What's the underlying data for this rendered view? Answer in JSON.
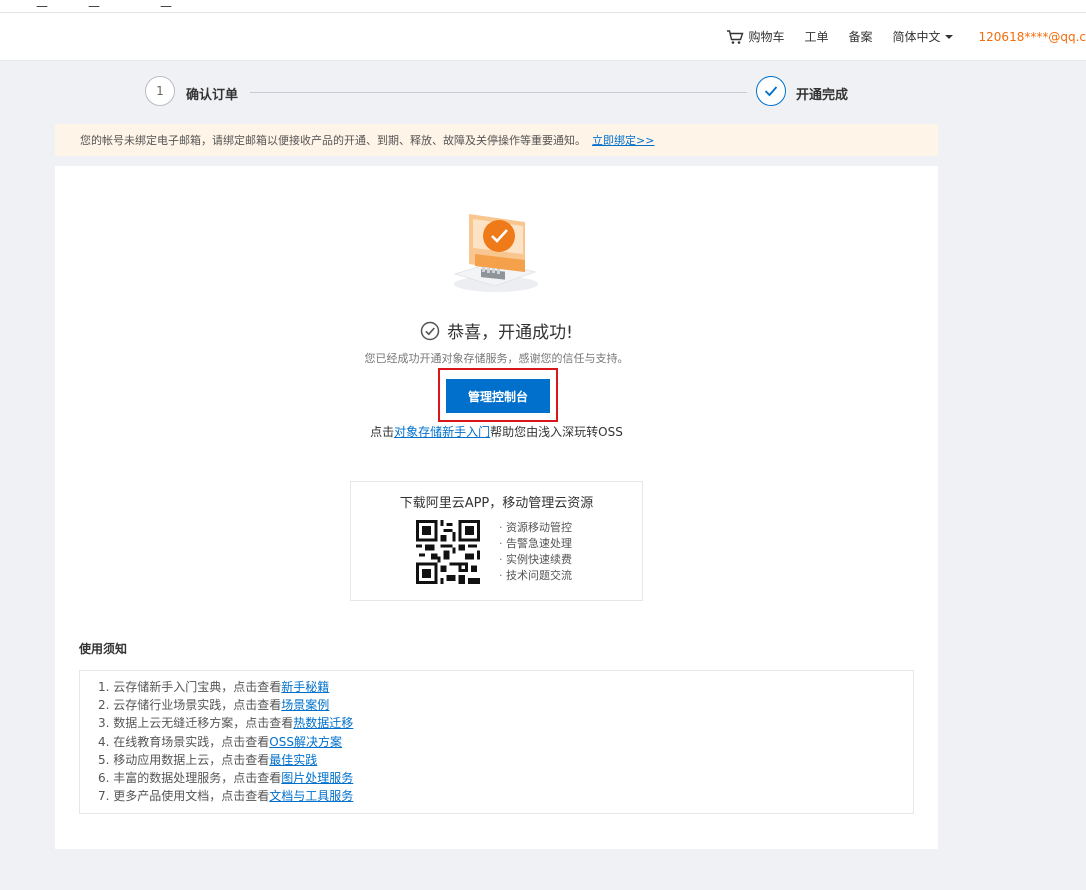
{
  "topbar": {
    "stubs": [
      "二",
      "二",
      "二"
    ]
  },
  "header": {
    "cart": "购物车",
    "ticket": "工单",
    "filing": "备案",
    "language": "简体中文",
    "user": "120618****@qq.c"
  },
  "steps": [
    {
      "number": "1",
      "label": "确认订单"
    },
    {
      "label": "开通完成"
    }
  ],
  "notice": {
    "text": "您的帐号未绑定电子邮箱，请绑定邮箱以便接收产品的开通、到期、释放、故障及关停操作等重要通知。",
    "link": "立即绑定>>"
  },
  "success": {
    "title": "恭喜，开通成功!",
    "subtitle": "您已经成功开通对象存储服务，感谢您的信任与支持。",
    "button": "管理控制台",
    "help_prefix": "点击",
    "help_link": "对象存储新手入门",
    "help_suffix": "帮助您由浅入深玩转OSS"
  },
  "app": {
    "title": "下载阿里云APP，移动管理云资源",
    "features": [
      "资源移动管控",
      "告警急速处理",
      "实例快速续费",
      "技术问题交流"
    ]
  },
  "usage": {
    "title": "使用须知",
    "items": [
      {
        "text": "1. 云存储新手入门宝典，点击查看",
        "link": "新手秘籍"
      },
      {
        "text": "2. 云存储行业场景实践，点击查看",
        "link": "场景案例"
      },
      {
        "text": "3. 数据上云无缝迁移方案，点击查看",
        "link": "热数据迁移"
      },
      {
        "text": "4. 在线教育场景实践，点击查看",
        "link": "OSS解决方案"
      },
      {
        "text": "5. 移动应用数据上云，点击查看",
        "link": "最佳实践"
      },
      {
        "text": "6. 丰富的数据处理服务，点击查看",
        "link": "图片处理服务"
      },
      {
        "text": "7. 更多产品使用文档，点击查看",
        "link": "文档与工具服务"
      }
    ]
  },
  "colors": {
    "primary": "#0070cc",
    "highlight": "#d9161b",
    "user": "#f56c0a",
    "notice_bg": "#fef4e8",
    "illustration": "#f5a04a"
  },
  "icons": [
    "cart-icon",
    "caret-down-icon",
    "check-icon",
    "check-circle-icon",
    "qr-code-icon",
    "success-illustration"
  ]
}
